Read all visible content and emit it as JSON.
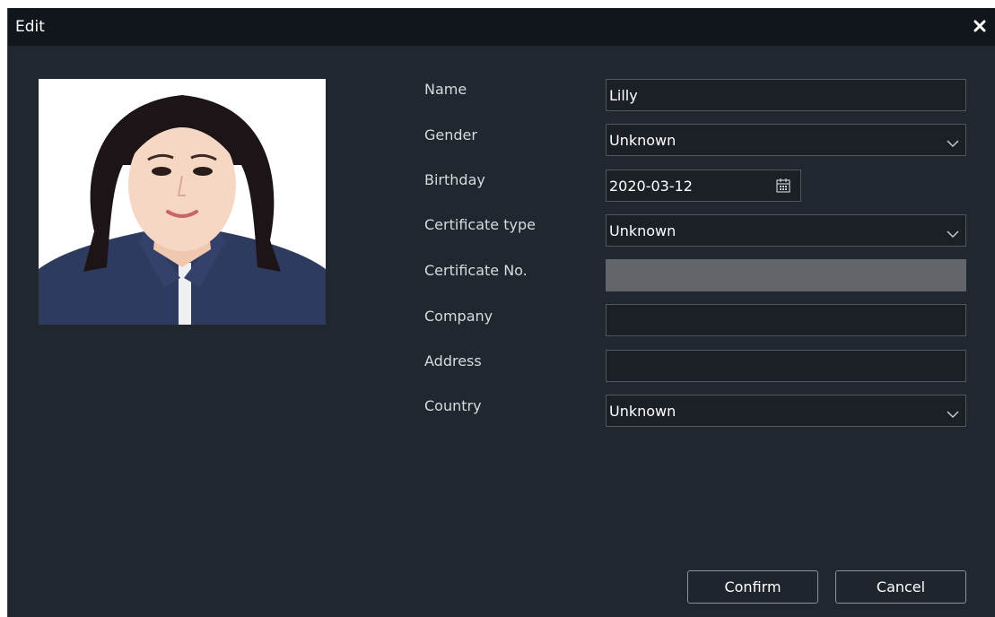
{
  "dialog": {
    "title": "Edit",
    "close_icon": "close-icon"
  },
  "photo": {
    "icon": "person-portrait-photo"
  },
  "form": {
    "name": {
      "label": "Name",
      "value": "Lilly"
    },
    "gender": {
      "label": "Gender",
      "value": "Unknown"
    },
    "birthday": {
      "label": "Birthday",
      "value": "2020-03-12",
      "icon": "calendar-icon"
    },
    "certificate_type": {
      "label": "Certificate type",
      "value": "Unknown"
    },
    "certificate_no": {
      "label": "Certificate No.",
      "value": ""
    },
    "company": {
      "label": "Company",
      "value": ""
    },
    "address": {
      "label": "Address",
      "value": ""
    },
    "country": {
      "label": "Country",
      "value": "Unknown"
    }
  },
  "buttons": {
    "confirm": "Confirm",
    "cancel": "Cancel"
  },
  "colors": {
    "title_bar": "#11161c",
    "dialog_bg": "#20272f",
    "input_bg": "#1b2026",
    "input_border": "#50575f",
    "disabled_input": "#626569"
  }
}
